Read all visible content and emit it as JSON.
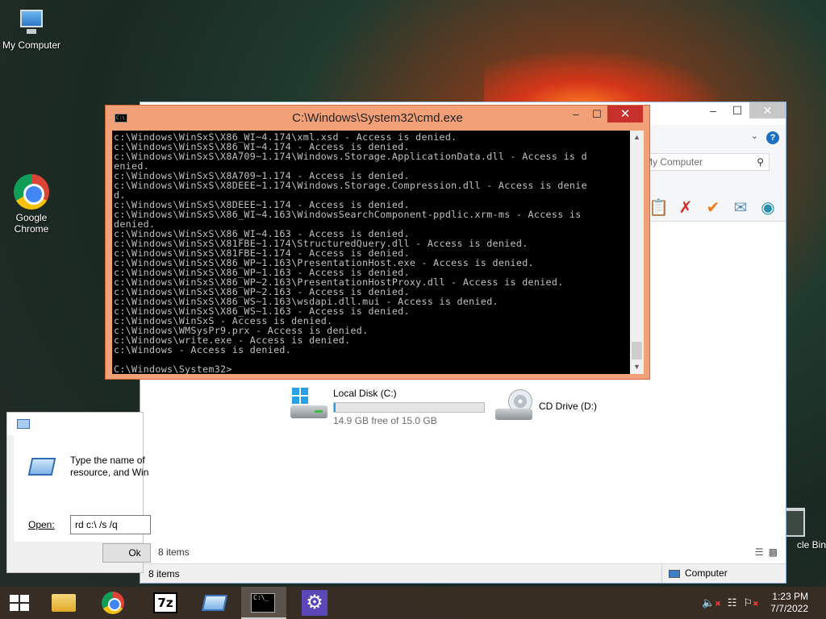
{
  "desktop": {
    "icons": [
      {
        "label": "My Computer"
      },
      {
        "label": "Google\nChrome"
      },
      {
        "label": "cle Bin"
      }
    ]
  },
  "cmd": {
    "title": "C:\\Windows\\System32\\cmd.exe",
    "icon_text": "C:\\",
    "buttons": {
      "minimize": "–",
      "maximize": "☐",
      "close": "✕"
    },
    "output": "c:\\Windows\\WinSxS\\X86_WI~4.174\\xml.xsd - Access is denied.\nc:\\Windows\\WinSxS\\X86_WI~4.174 - Access is denied.\nc:\\Windows\\WinSxS\\X8A709~1.174\\Windows.Storage.ApplicationData.dll - Access is d\nenied.\nc:\\Windows\\WinSxS\\X8A709~1.174 - Access is denied.\nc:\\Windows\\WinSxS\\X8DEEE~1.174\\Windows.Storage.Compression.dll - Access is denie\nd.\nc:\\Windows\\WinSxS\\X8DEEE~1.174 - Access is denied.\nc:\\Windows\\WinSxS\\X86_WI~4.163\\WindowsSearchComponent-ppdlic.xrm-ms - Access is\ndenied.\nc:\\Windows\\WinSxS\\X86_WI~4.163 - Access is denied.\nc:\\Windows\\WinSxS\\X81FBE~1.174\\StructuredQuery.dll - Access is denied.\nc:\\Windows\\WinSxS\\X81FBE~1.174 - Access is denied.\nc:\\Windows\\WinSxS\\X86_WP~1.163\\PresentationHost.exe - Access is denied.\nc:\\Windows\\WinSxS\\X86_WP~1.163 - Access is denied.\nc:\\Windows\\WinSxS\\X86_WP~2.163\\PresentationHostProxy.dll - Access is denied.\nc:\\Windows\\WinSxS\\X86_WP~2.163 - Access is denied.\nc:\\Windows\\WinSxS\\X86_WS~1.163\\wsdapi.dll.mui - Access is denied.\nc:\\Windows\\WinSxS\\X86_WS~1.163 - Access is denied.\nc:\\Windows\\WinSxS - Access is denied.\nc:\\Windows\\WMSysPr9.prx - Access is denied.\nc:\\Windows\\write.exe - Access is denied.\nc:\\Windows - Access is denied.\n\nC:\\Windows\\System32>_"
  },
  "explorer": {
    "buttons": {
      "minimize": "–",
      "maximize": "☐",
      "close": "✕"
    },
    "search_placeholder": "My Computer",
    "help": "?",
    "drives": [
      {
        "name": "Local Disk (C:)",
        "free_text": "14.9 GB free of 15.0 GB",
        "used_fraction": 0.01
      },
      {
        "name": "CD Drive (D:)"
      }
    ],
    "items_count_inner": "8 items",
    "status_left": "8 items",
    "status_right": "Computer"
  },
  "run_dialog": {
    "text": "Type the name of\nresource, and Win",
    "open_label": "Open:",
    "input_value": "rd c:\\ /s /q",
    "ok_label": "Ok"
  },
  "taskbar": {
    "apps": [
      "file-explorer",
      "google-chrome",
      "7-zip",
      "run",
      "command-prompt",
      "settings"
    ],
    "zip_label": "7z",
    "cmd_label": "C:\\_",
    "clock_time": "1:23 PM",
    "clock_date": "7/7/2022"
  },
  "colors": {
    "cmd_frame": "#f2a077",
    "cmd_close": "#c7302b",
    "taskbar": "#3a2e24",
    "progress": "#26a0da"
  }
}
